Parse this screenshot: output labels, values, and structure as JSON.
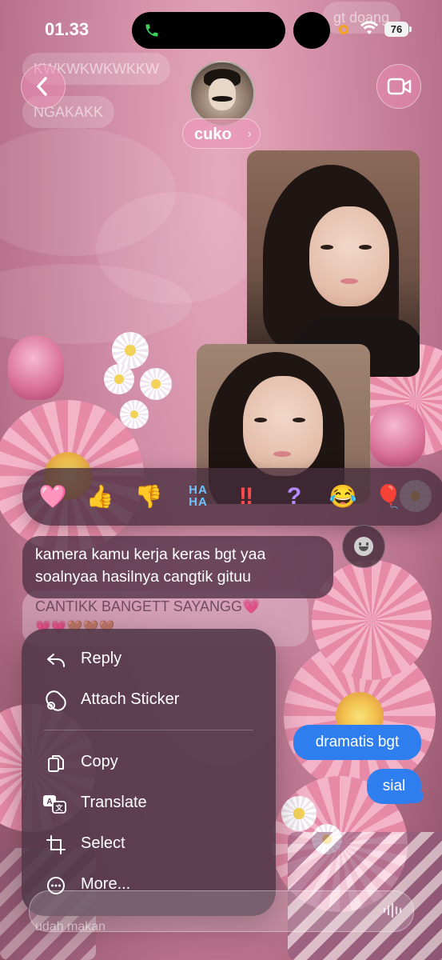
{
  "status_bar": {
    "time": "01.33",
    "battery": "76"
  },
  "background_messages": {
    "top_right": "gt doang",
    "top_left_1": "KWKWKWKWKKW",
    "top_left_2": "NGAKAKK"
  },
  "header": {
    "contact_name": "cuko"
  },
  "reactions": [
    {
      "name": "heart",
      "glyph": "🩷"
    },
    {
      "name": "thumbs-up",
      "glyph": "👍"
    },
    {
      "name": "thumbs-down",
      "glyph": "👎"
    },
    {
      "name": "haha",
      "glyph": "HA HA"
    },
    {
      "name": "exclamation",
      "glyph": "‼"
    },
    {
      "name": "question",
      "glyph": "?"
    },
    {
      "name": "laughing",
      "glyph": "😂"
    },
    {
      "name": "balloon",
      "glyph": "🎈"
    }
  ],
  "selected_message": {
    "line1": "kamera kamu kerja keras bgt yaa",
    "line2": "soalnyaa hasilnya cangtik gituu"
  },
  "behind_message": {
    "text": "CANTIKK BANGETT SAYANGG💗",
    "emoji_line": "💗💗🤎🤎🤎"
  },
  "context_menu": {
    "items": [
      {
        "label": "Reply",
        "icon": "reply-icon"
      },
      {
        "label": "Attach Sticker",
        "icon": "sticker-icon"
      },
      {
        "label": "Copy",
        "icon": "copy-icon"
      },
      {
        "label": "Translate",
        "icon": "translate-icon"
      },
      {
        "label": "Select",
        "icon": "crop-select-icon"
      },
      {
        "label": "More...",
        "icon": "more-icon"
      }
    ]
  },
  "outgoing_messages": [
    "dramatis bgt",
    "sial"
  ],
  "input": {
    "ghost_text": "udah makan"
  },
  "colors": {
    "outgoing_bubble": "#2f7ef0",
    "menu_bg": "#50374a",
    "accent_pink": "#eb8cb4"
  }
}
